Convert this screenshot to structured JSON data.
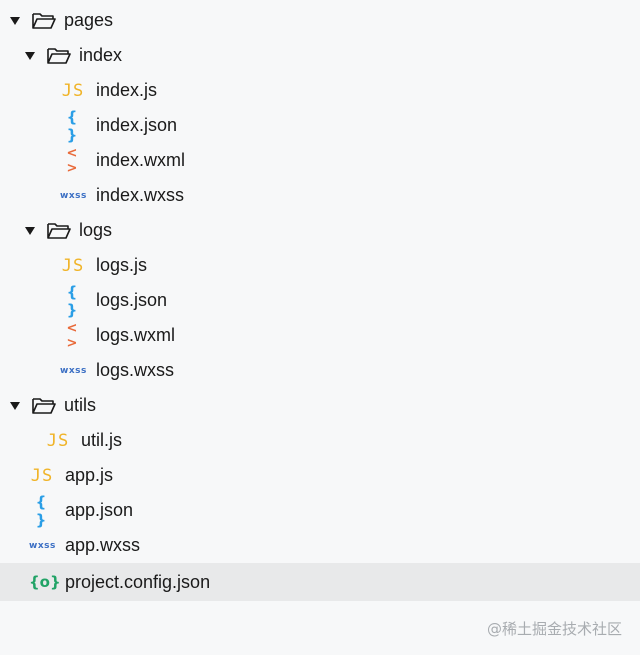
{
  "tree": {
    "pages": {
      "name": "pages",
      "expanded": true
    },
    "index": {
      "name": "index",
      "expanded": true
    },
    "index_js": {
      "name": "index.js",
      "icon": "JS"
    },
    "index_json": {
      "name": "index.json",
      "icon": "{ }"
    },
    "index_wxml": {
      "name": "index.wxml",
      "icon": "< >"
    },
    "index_wxss": {
      "name": "index.wxss",
      "icon": "wxss"
    },
    "logs": {
      "name": "logs",
      "expanded": true
    },
    "logs_js": {
      "name": "logs.js",
      "icon": "JS"
    },
    "logs_json": {
      "name": "logs.json",
      "icon": "{ }"
    },
    "logs_wxml": {
      "name": "logs.wxml",
      "icon": "< >"
    },
    "logs_wxss": {
      "name": "logs.wxss",
      "icon": "wxss"
    },
    "utils": {
      "name": "utils",
      "expanded": true
    },
    "util_js": {
      "name": "util.js",
      "icon": "JS"
    },
    "app_js": {
      "name": "app.js",
      "icon": "JS"
    },
    "app_json": {
      "name": "app.json",
      "icon": "{ }"
    },
    "app_wxss": {
      "name": "app.wxss",
      "icon": "wxss"
    },
    "project_config": {
      "name": "project.config.json",
      "icon": "{o}",
      "selected": true
    }
  },
  "colors": {
    "js": "#f0b429",
    "json": "#2a9ee6",
    "wxml": "#e86a3a",
    "wxss": "#3b6fc4",
    "config": "#21a366",
    "selected_bg": "#e8e9ea"
  },
  "watermark": "@稀土掘金技术社区"
}
